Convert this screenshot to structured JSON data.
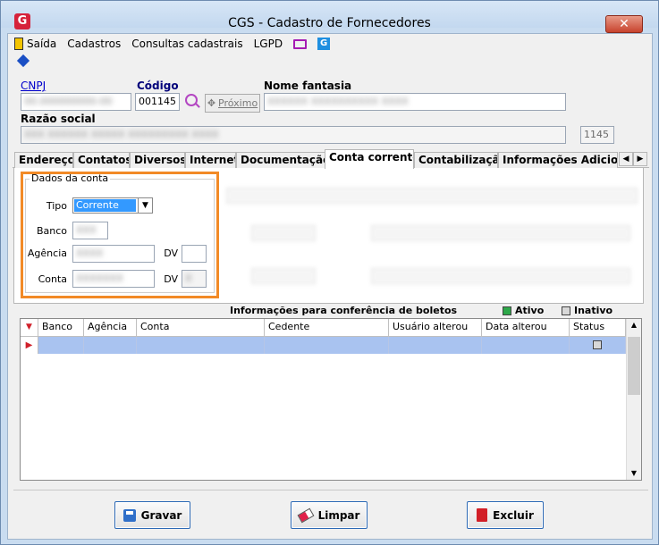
{
  "window": {
    "title": "CGS - Cadastro de Fornecedores",
    "logo_letter": "G",
    "close_symbol": "✕"
  },
  "menu": [
    {
      "label": "Saída",
      "icon": "door-icon"
    },
    {
      "label": "Cadastros"
    },
    {
      "label": "Consultas cadastrais"
    },
    {
      "label": "LGPD"
    }
  ],
  "header": {
    "cnpj_label": "CNPJ",
    "cnpj_value": "00.000000000-00",
    "codigo_label": "Código",
    "codigo_value": "001145",
    "proximo_label": "Próximo",
    "nome_fantasia_label": "Nome fantasia",
    "nome_fantasia_value": "XXXXXX XXXXXXXXXX XXXX",
    "razao_social_label": "Razão social",
    "razao_social_value": "XXX XXXXXX XXXXX XXXXXXXXX XXXX",
    "code_short": "1145"
  },
  "tabs": [
    "Endereço",
    "Contatos",
    "Diversos",
    "Internet",
    "Documentação",
    "Conta corrente",
    "Contabilização",
    "Informações Adicionais"
  ],
  "active_tab": "Conta corrente",
  "dados_conta": {
    "group_title": "Dados da conta",
    "tipo_label": "Tipo",
    "tipo_value": "Corrente",
    "banco_label": "Banco",
    "banco_value": "XXX",
    "agencia_label": "Agência",
    "agencia_value": "XXXX",
    "dv_label": "DV",
    "conta_label": "Conta",
    "conta_value": "XXXXXXX",
    "dv2_label": "DV",
    "dv2_value": "X"
  },
  "grid": {
    "caption": "Informações para conferência de boletos",
    "ativo_label": "Ativo",
    "inativo_label": "Inativo",
    "columns": [
      "Banco",
      "Agência",
      "Conta",
      "Cedente",
      "Usuário alterou",
      "Data alterou",
      "Status"
    ]
  },
  "buttons": {
    "gravar": "Gravar",
    "limpar": "Limpar",
    "excluir": "Excluir"
  },
  "colors": {
    "highlight": "#f28a26",
    "selection": "#3399ff",
    "grid_row": "#a9c3f0",
    "ativo_green": "#2ea84a"
  }
}
